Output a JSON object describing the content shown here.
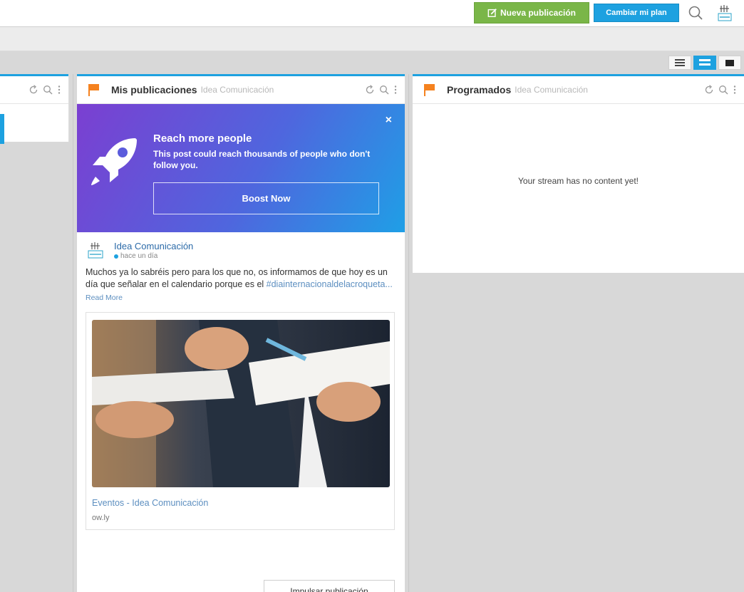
{
  "topbar": {
    "new_post_label": "Nueva publicación",
    "change_plan_label": "Cambiar mi plan",
    "search_icon": "search-icon",
    "avatar_icon": "idea-logo"
  },
  "view_toggle": [
    "list-icon",
    "compact-icon",
    "wide-icon"
  ],
  "columns": {
    "mine": {
      "title": "Mis publicaciones",
      "subtitle": "Idea Comunicación"
    },
    "scheduled": {
      "title": "Programados",
      "subtitle": "Idea Comunicación",
      "empty_text": "Your stream has no content yet!"
    }
  },
  "promo": {
    "title": "Reach more people",
    "text": "This post could reach thousands of people who don't follow you.",
    "button": "Boost Now",
    "close": "×"
  },
  "post": {
    "author": "Idea Comunicación",
    "time": "hace un día",
    "text": "Muchos ya lo sabréis pero para los que no, os informamos de que hoy es un día que señalar en el calendario porque es el ",
    "hashtag": "#diainternacionaldelacroqueta...",
    "read_more": "Read More",
    "link_title": "Eventos - Idea Comunicación",
    "link_domain": "ow.ly",
    "boost_button": "Impulsar publicación"
  },
  "colors": {
    "accent": "#1da1e0",
    "green": "#7ab648",
    "flag": "#f5821f"
  }
}
